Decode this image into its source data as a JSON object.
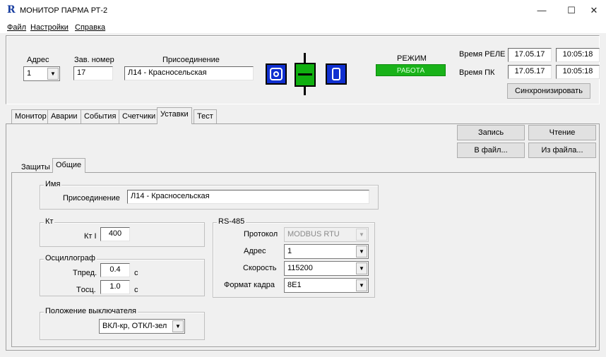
{
  "window": {
    "title": "МОНИТОР ПАРМА РТ-2",
    "logo": "R",
    "minimize": "—",
    "maximize": "☐",
    "close": "✕"
  },
  "menu": [
    "Файл",
    "Настройки",
    "Справка"
  ],
  "header": {
    "address_label": "Адрес",
    "address_value": "1",
    "serial_label": "Зав. номер",
    "serial_value": "17",
    "connection_label": "Присоединение",
    "connection_value": "Л14 - Красносельская",
    "mode_label": "РЕЖИМ",
    "mode_value": "РАБОТА",
    "relay_time_label": "Время РЕЛЕ",
    "relay_date": "17.05.17",
    "relay_time": "10:05:18",
    "pc_time_label": "Время ПК",
    "pc_date": "17.05.17",
    "pc_time": "10:05:18",
    "sync_button": "Синхронизировать"
  },
  "tabs": [
    "Монитор",
    "Аварии",
    "События",
    "Счетчики",
    "Уставки",
    "Тест"
  ],
  "active_tab": "Уставки",
  "actions": {
    "write": "Запись",
    "read": "Чтение",
    "to_file": "В файл...",
    "from_file": "Из файла..."
  },
  "subtabs": [
    "Защиты",
    "Общие"
  ],
  "active_subtab": "Общие",
  "name_group": {
    "title": "Имя",
    "connection_label": "Присоединение",
    "connection_value": "Л14 - Красносельская"
  },
  "kt_group": {
    "title": "Кт",
    "kt_label": "Кт I",
    "kt_value": "400"
  },
  "osc_group": {
    "title": "Осциллограф",
    "tpred_label": "Tпред.",
    "tpred_value": "0.4",
    "tpred_unit": "с",
    "tosc_label": "Tосц.",
    "tosc_value": "1.0",
    "tosc_unit": "с"
  },
  "breaker_group": {
    "title": "Положение выключателя",
    "value": "ВКЛ-кр, ОТКЛ-зел"
  },
  "rs485_group": {
    "title": "RS-485",
    "protocol_label": "Протокол",
    "protocol_value": "MODBUS RTU",
    "address_label": "Адрес",
    "address_value": "1",
    "speed_label": "Скорость",
    "speed_value": "115200",
    "frame_label": "Формат кадра",
    "frame_value": "8E1"
  },
  "colors": {
    "mode_bg": "#19b219",
    "icon_blue": "#1030d0",
    "icon_green": "#10b010"
  }
}
